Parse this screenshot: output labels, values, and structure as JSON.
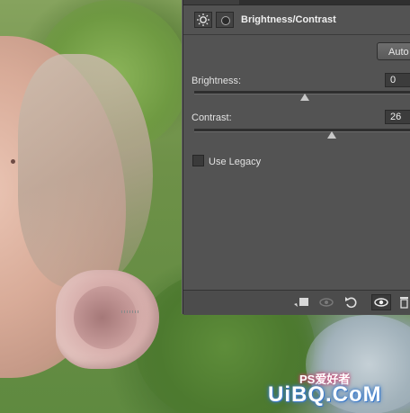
{
  "panel": {
    "title": "Brightness/Contrast",
    "icons": [
      "brightness-sun-icon",
      "layer-mask-icon"
    ],
    "auto_label": "Auto",
    "brightness": {
      "label": "Brightness:",
      "value": "0",
      "level": 0.5
    },
    "contrast": {
      "label": "Contrast:",
      "value": "26",
      "level": 0.626
    },
    "use_legacy": {
      "label": "Use Legacy",
      "checked": false
    },
    "footer_icons": [
      "clip-to-layer-icon",
      "view-previous-state-icon",
      "reset-icon",
      "visibility-eye-icon",
      "delete-icon"
    ]
  },
  "watermark": {
    "main": "UiBQ.CoM",
    "small": "PS爱好者"
  },
  "colors": {
    "panel_bg": "#535353",
    "text": "#e2e2e2",
    "field_bg": "#3c3c3c"
  }
}
